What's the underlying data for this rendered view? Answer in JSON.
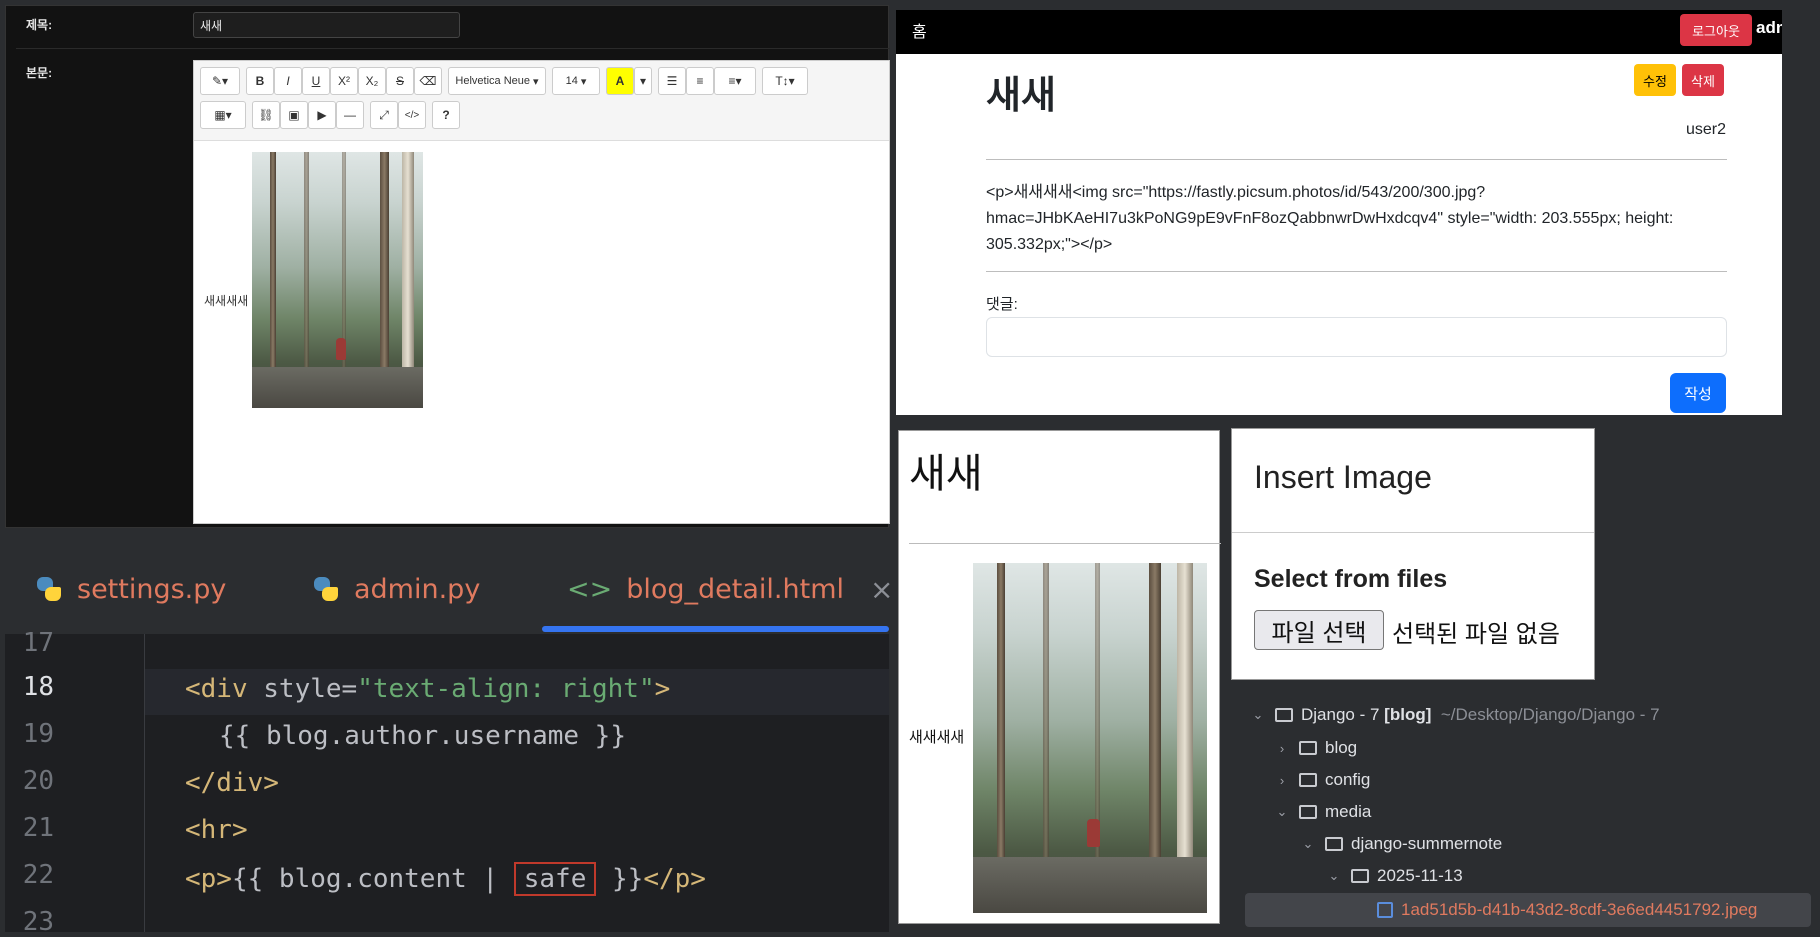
{
  "admin": {
    "title_label": "제목:",
    "title_value": "새새",
    "body_label": "본문:",
    "toolbar": {
      "font_name": "Helvetica Neue",
      "font_size": "14",
      "bold": "B",
      "italic": "I",
      "underline": "U",
      "superscript": "X²",
      "subscript": "X₂",
      "strike": "S",
      "help": "?",
      "code": "</>",
      "highlight": "A",
      "text_size": "T↕"
    },
    "editor_text": "새새새새"
  },
  "ide": {
    "tabs": [
      {
        "label": "settings.py",
        "color": "#e07a5f"
      },
      {
        "label": "admin.py",
        "color": "#e07a5f"
      },
      {
        "label": "blog_detail.html",
        "color": "#e07a5f"
      }
    ],
    "close_glyph": "×",
    "line_numbers": [
      "17",
      "18",
      "19",
      "20",
      "21",
      "22",
      "23"
    ],
    "code": {
      "l18_open": "<div",
      "l18_attr": " style=",
      "l18_val": "\"text-align: right\"",
      "l18_close": ">",
      "l19": "{{ blog.author.username }}",
      "l20": "</div>",
      "l21": "<hr>",
      "l22_a": "<p>",
      "l22_b": "{{ blog.content |",
      "l22_safe": "safe",
      "l22_c": " }}",
      "l22_d": "</p>"
    }
  },
  "detail": {
    "nav_home": "홈",
    "logout": "로그아웃",
    "nav_user": "admin",
    "title": "새새",
    "edit": "수정",
    "delete": "삭제",
    "author": "user2",
    "content_raw": "<p>새새새새<img src=\"https://fastly.picsum.photos/id/543/200/300.jpg?hmac=JHbKAeHI7u3kPoNG9pE9vFnF8ozQabbnwrDwHxdcqv4\" style=\"width: 203.555px; height: 305.332px;\"></p>",
    "comment_label": "댓글:",
    "submit": "작성"
  },
  "rendered": {
    "title": "새새",
    "text": "새새새새"
  },
  "modal": {
    "title": "Insert Image",
    "subtitle": "Select from files",
    "file_button": "파일 선택",
    "file_status": "선택된 파일 없음"
  },
  "tree": {
    "root_name": "Django - 7",
    "root_tag": "[blog]",
    "root_path": "~/Desktop/Django/Django - 7",
    "items": [
      {
        "label": "blog"
      },
      {
        "label": "config"
      },
      {
        "label": "media"
      },
      {
        "label": "django-summernote"
      },
      {
        "label": "2025-11-13"
      },
      {
        "label": "1ad51d5b-d41b-43d2-8cdf-3e6ed4451792.jpeg"
      }
    ]
  }
}
